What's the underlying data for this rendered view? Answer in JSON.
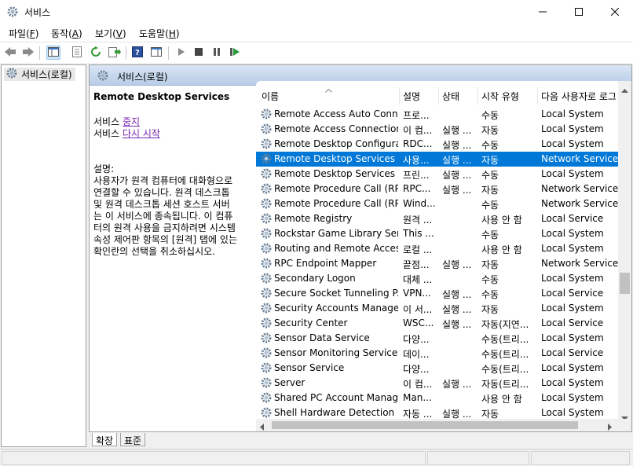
{
  "window": {
    "title": "서비스",
    "minimize_icon": "minimize-icon",
    "maximize_icon": "maximize-icon",
    "close_icon": "close-icon"
  },
  "menu": [
    {
      "label": "파일",
      "key": "F"
    },
    {
      "label": "동작",
      "key": "A"
    },
    {
      "label": "보기",
      "key": "V"
    },
    {
      "label": "도움말",
      "key": "H"
    }
  ],
  "toolbar": {
    "icons": [
      "back-arrow-icon",
      "forward-arrow-icon",
      "console-tree-icon",
      "properties-icon",
      "refresh-icon",
      "export-list-icon",
      "help-icon",
      "show-hide-pane-icon",
      "start-service-icon",
      "stop-service-icon",
      "pause-service-icon",
      "restart-service-icon"
    ]
  },
  "tree": {
    "root_label": "서비스(로컬)"
  },
  "banner": {
    "title": "서비스(로컬)"
  },
  "details": {
    "service_name": "Remote Desktop Services",
    "stop_prefix": "서비스",
    "stop_link": "중지",
    "restart_prefix": "서비스",
    "restart_link": "다시 시작",
    "desc_label": "설명:",
    "desc_lines": [
      "사용자가 원격 컴퓨터에 대화형으로",
      "연결할 수 있습니다. 원격 데스크톱",
      "및 원격 데스크톱 세션 호스트 서버",
      "는 이 서비스에 종속됩니다. 이 컴퓨",
      "터의 원격 사용을 금지하려면 시스템",
      "속성 제어판 항목의 [원격] 탭에 있는",
      "확인란의 선택을 취소하십시오."
    ]
  },
  "columns": [
    "이름",
    "설명",
    "상태",
    "시작 유형",
    "다음 사용자로 로그"
  ],
  "services": [
    {
      "name": "Remote Access Auto Conn...",
      "desc": "프로...",
      "status": "",
      "startup": "수동",
      "logon": "Local System"
    },
    {
      "name": "Remote Access Connection...",
      "desc": "이 컴...",
      "status": "실행 ...",
      "startup": "자동",
      "logon": "Local System"
    },
    {
      "name": "Remote Desktop Configura...",
      "desc": "RDC...",
      "status": "실행 ...",
      "startup": "수동",
      "logon": "Local System"
    },
    {
      "name": "Remote Desktop Services",
      "desc": "사용...",
      "status": "실행 ...",
      "startup": "자동",
      "logon": "Network Service",
      "selected": true
    },
    {
      "name": "Remote Desktop Services ...",
      "desc": "프린...",
      "status": "실행 ...",
      "startup": "수동",
      "logon": "Local System"
    },
    {
      "name": "Remote Procedure Call (RP...",
      "desc": "RPC...",
      "status": "실행 ...",
      "startup": "자동",
      "logon": "Network Service"
    },
    {
      "name": "Remote Procedure Call (RP...",
      "desc": "Wind...",
      "status": "",
      "startup": "수동",
      "logon": "Network Service"
    },
    {
      "name": "Remote Registry",
      "desc": "원격 ...",
      "status": "",
      "startup": "사용 안 함",
      "logon": "Local Service"
    },
    {
      "name": "Rockstar Game Library Serv...",
      "desc": "This ...",
      "status": "",
      "startup": "수동",
      "logon": "Local System"
    },
    {
      "name": "Routing and Remote Access",
      "desc": "로컬 ...",
      "status": "",
      "startup": "사용 안 함",
      "logon": "Local System"
    },
    {
      "name": "RPC Endpoint Mapper",
      "desc": "끝점...",
      "status": "실행 ...",
      "startup": "자동",
      "logon": "Network Service"
    },
    {
      "name": "Secondary Logon",
      "desc": "대체 ...",
      "status": "",
      "startup": "수동",
      "logon": "Local System"
    },
    {
      "name": "Secure Socket Tunneling P...",
      "desc": "VPN...",
      "status": "실행 ...",
      "startup": "수동",
      "logon": "Local Service"
    },
    {
      "name": "Security Accounts Manager",
      "desc": "이 서...",
      "status": "실행 ...",
      "startup": "자동",
      "logon": "Local System"
    },
    {
      "name": "Security Center",
      "desc": "WSC...",
      "status": "실행 ...",
      "startup": "자동(지연...",
      "logon": "Local Service"
    },
    {
      "name": "Sensor Data Service",
      "desc": "다양...",
      "status": "",
      "startup": "수동(트리...",
      "logon": "Local System"
    },
    {
      "name": "Sensor Monitoring Service",
      "desc": "데이...",
      "status": "",
      "startup": "수동(트리...",
      "logon": "Local Service"
    },
    {
      "name": "Sensor Service",
      "desc": "다양...",
      "status": "",
      "startup": "수동(트리...",
      "logon": "Local System"
    },
    {
      "name": "Server",
      "desc": "이 컴...",
      "status": "실행 ...",
      "startup": "자동(트리...",
      "logon": "Local System"
    },
    {
      "name": "Shared PC Account Manager",
      "desc": "Man...",
      "status": "",
      "startup": "사용 안 함",
      "logon": "Local System"
    },
    {
      "name": "Shell Hardware Detection",
      "desc": "자동 ...",
      "status": "실행 ...",
      "startup": "자동",
      "logon": "Local System"
    }
  ],
  "tabs": [
    {
      "label": "확장"
    },
    {
      "label": "표준"
    }
  ],
  "colors": {
    "selection": "#0078d7",
    "link": "#7a22b0",
    "banner": "#c9dbf0"
  }
}
